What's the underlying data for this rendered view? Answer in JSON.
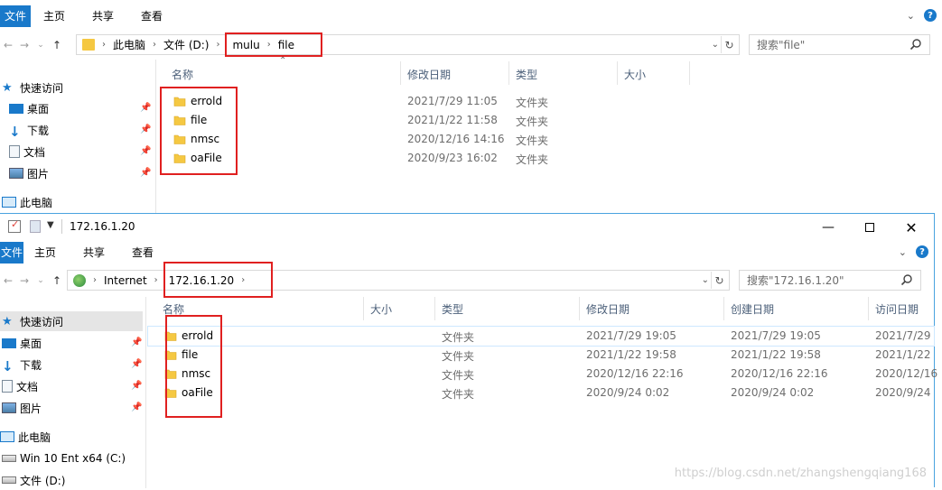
{
  "ribbon_tabs": {
    "file": "文件",
    "home": "主页",
    "share": "共享",
    "view": "查看"
  },
  "window1": {
    "address": {
      "segments": [
        "此电脑",
        "文件 (D:)",
        "mulu",
        "file"
      ]
    },
    "search_placeholder": "搜索\"file\"",
    "nav": {
      "quick_access": "快速访问",
      "items": [
        "桌面",
        "下载",
        "文档",
        "图片"
      ],
      "this_pc": "此电脑"
    },
    "columns": {
      "name": "名称",
      "modified": "修改日期",
      "type": "类型",
      "size": "大小"
    },
    "files": [
      {
        "name": "errold",
        "modified": "2021/7/29 11:05",
        "type": "文件夹"
      },
      {
        "name": "file",
        "modified": "2021/1/22 11:58",
        "type": "文件夹"
      },
      {
        "name": "nmsc",
        "modified": "2020/12/16 14:16",
        "type": "文件夹"
      },
      {
        "name": "oaFile",
        "modified": "2020/9/23 16:02",
        "type": "文件夹"
      }
    ]
  },
  "window2": {
    "title": "172.16.1.20",
    "address": {
      "segments": [
        "Internet",
        "172.16.1.20"
      ]
    },
    "search_placeholder": "搜索\"172.16.1.20\"",
    "nav": {
      "quick_access": "快速访问",
      "items": [
        "桌面",
        "下载",
        "文档",
        "图片"
      ],
      "this_pc": "此电脑",
      "drives": [
        "Win 10 Ent x64 (C:)",
        "文件 (D:)"
      ]
    },
    "columns": {
      "name": "名称",
      "size": "大小",
      "type": "类型",
      "modified": "修改日期",
      "created": "创建日期",
      "accessed": "访问日期"
    },
    "files": [
      {
        "name": "errold",
        "type": "文件夹",
        "modified": "2021/7/29 19:05",
        "created": "2021/7/29 19:05",
        "accessed": "2021/7/29"
      },
      {
        "name": "file",
        "type": "文件夹",
        "modified": "2021/1/22 19:58",
        "created": "2021/1/22 19:58",
        "accessed": "2021/1/22"
      },
      {
        "name": "nmsc",
        "type": "文件夹",
        "modified": "2020/12/16 22:16",
        "created": "2020/12/16 22:16",
        "accessed": "2020/12/16"
      },
      {
        "name": "oaFile",
        "type": "文件夹",
        "modified": "2020/9/24 0:02",
        "created": "2020/9/24 0:02",
        "accessed": "2020/9/24"
      }
    ]
  },
  "watermark": "https://blog.csdn.net/zhangshengqiang168",
  "colors": {
    "accent": "#1979ca",
    "highlight": "#e02020",
    "folder": "#f5c842"
  }
}
